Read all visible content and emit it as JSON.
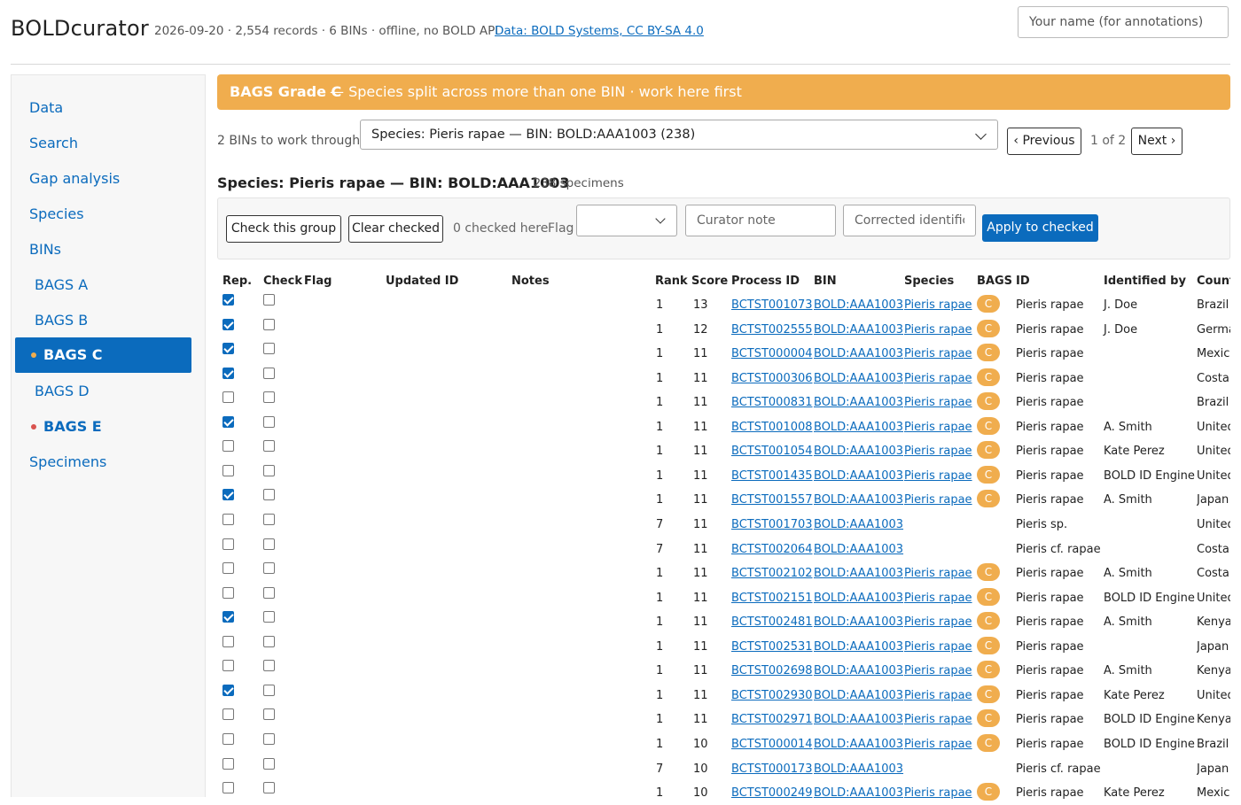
{
  "header": {
    "app_title": "BOLDcurator",
    "meta": "2026-09-20 · 2,554 records · 6 BINs · offline, no BOLD API",
    "data_link": "Data: BOLD Systems, CC BY-SA 4.0",
    "name_placeholder": "Your name (for annotations)"
  },
  "sidebar": {
    "items": [
      "Data",
      "Search",
      "Gap analysis",
      "Species",
      "BINs"
    ],
    "bags": [
      "BAGS A",
      "BAGS B",
      "BAGS C",
      "BAGS D",
      "BAGS E"
    ],
    "active": "BAGS C",
    "specimens": "Specimens",
    "dot_colors": {
      "bags_c": "#f0ad4e",
      "bags_e": "#d9534f"
    }
  },
  "banner": {
    "grade": "BAGS Grade C",
    "desc": "— Species split across more than one BIN · work here first",
    "color": "#f0ad4e"
  },
  "nav": {
    "work_label": "2 BINs to work through",
    "selected": "Species: Pieris rapae — BIN: BOLD:AAA1003 (238)",
    "prev": "‹ Previous",
    "page": "1 of 2",
    "next": "Next ›"
  },
  "group": {
    "title": "Species: Pieris rapae — BIN: BOLD:AAA1003",
    "count": "· 238 specimens"
  },
  "actions": {
    "check_group": "Check this group",
    "clear_checked": "Clear checked",
    "checked_count": "0 checked here",
    "flag_label": "Flag",
    "note_placeholder": "Curator note",
    "corrected_placeholder": "Corrected identification",
    "apply": "Apply to checked"
  },
  "table": {
    "headers": [
      "Rep.",
      "Check",
      "Flag",
      "Updated ID",
      "Notes",
      "Rank",
      "Score",
      "Process ID",
      "BIN",
      "Species",
      "BAGS",
      "ID",
      "Identified by",
      "Country"
    ],
    "rows": [
      {
        "rep": true,
        "rank": "1",
        "score": "13",
        "pid": "BCTST001073",
        "bin": "BOLD:AAA1003",
        "species": "Pieris rapae",
        "bags": "C",
        "id": "Pieris rapae",
        "by": "J. Doe",
        "country": "Brazil"
      },
      {
        "rep": true,
        "rank": "1",
        "score": "12",
        "pid": "BCTST002555",
        "bin": "BOLD:AAA1003",
        "species": "Pieris rapae",
        "bags": "C",
        "id": "Pieris rapae",
        "by": "J. Doe",
        "country": "Germany"
      },
      {
        "rep": true,
        "rank": "1",
        "score": "11",
        "pid": "BCTST000004",
        "bin": "BOLD:AAA1003",
        "species": "Pieris rapae",
        "bags": "C",
        "id": "Pieris rapae",
        "by": "",
        "country": "Mexico"
      },
      {
        "rep": true,
        "rank": "1",
        "score": "11",
        "pid": "BCTST000306",
        "bin": "BOLD:AAA1003",
        "species": "Pieris rapae",
        "bags": "C",
        "id": "Pieris rapae",
        "by": "",
        "country": "Costa Rica"
      },
      {
        "rep": false,
        "rank": "1",
        "score": "11",
        "pid": "BCTST000831",
        "bin": "BOLD:AAA1003",
        "species": "Pieris rapae",
        "bags": "C",
        "id": "Pieris rapae",
        "by": "",
        "country": "Brazil"
      },
      {
        "rep": true,
        "rank": "1",
        "score": "11",
        "pid": "BCTST001008",
        "bin": "BOLD:AAA1003",
        "species": "Pieris rapae",
        "bags": "C",
        "id": "Pieris rapae",
        "by": "A. Smith",
        "country": "United States"
      },
      {
        "rep": false,
        "rank": "1",
        "score": "11",
        "pid": "BCTST001054",
        "bin": "BOLD:AAA1003",
        "species": "Pieris rapae",
        "bags": "C",
        "id": "Pieris rapae",
        "by": "Kate Perez",
        "country": "United States"
      },
      {
        "rep": false,
        "rank": "1",
        "score": "11",
        "pid": "BCTST001435",
        "bin": "BOLD:AAA1003",
        "species": "Pieris rapae",
        "bags": "C",
        "id": "Pieris rapae",
        "by": "BOLD ID Engine",
        "country": "United States"
      },
      {
        "rep": true,
        "rank": "1",
        "score": "11",
        "pid": "BCTST001557",
        "bin": "BOLD:AAA1003",
        "species": "Pieris rapae",
        "bags": "C",
        "id": "Pieris rapae",
        "by": "A. Smith",
        "country": "Japan"
      },
      {
        "rep": false,
        "rank": "7",
        "score": "11",
        "pid": "BCTST001703",
        "bin": "BOLD:AAA1003",
        "species": "",
        "bags": "",
        "id": "Pieris sp.",
        "by": "",
        "country": "United States"
      },
      {
        "rep": false,
        "rank": "7",
        "score": "11",
        "pid": "BCTST002064",
        "bin": "BOLD:AAA1003",
        "species": "",
        "bags": "",
        "id": "Pieris cf. rapae",
        "by": "",
        "country": "Costa Rica"
      },
      {
        "rep": false,
        "rank": "1",
        "score": "11",
        "pid": "BCTST002102",
        "bin": "BOLD:AAA1003",
        "species": "Pieris rapae",
        "bags": "C",
        "id": "Pieris rapae",
        "by": "A. Smith",
        "country": "Costa Rica"
      },
      {
        "rep": false,
        "rank": "1",
        "score": "11",
        "pid": "BCTST002151",
        "bin": "BOLD:AAA1003",
        "species": "Pieris rapae",
        "bags": "C",
        "id": "Pieris rapae",
        "by": "BOLD ID Engine",
        "country": "United States"
      },
      {
        "rep": true,
        "rank": "1",
        "score": "11",
        "pid": "BCTST002481",
        "bin": "BOLD:AAA1003",
        "species": "Pieris rapae",
        "bags": "C",
        "id": "Pieris rapae",
        "by": "A. Smith",
        "country": "Kenya"
      },
      {
        "rep": false,
        "rank": "1",
        "score": "11",
        "pid": "BCTST002531",
        "bin": "BOLD:AAA1003",
        "species": "Pieris rapae",
        "bags": "C",
        "id": "Pieris rapae",
        "by": "",
        "country": "Japan"
      },
      {
        "rep": false,
        "rank": "1",
        "score": "11",
        "pid": "BCTST002698",
        "bin": "BOLD:AAA1003",
        "species": "Pieris rapae",
        "bags": "C",
        "id": "Pieris rapae",
        "by": "A. Smith",
        "country": "Kenya"
      },
      {
        "rep": true,
        "rank": "1",
        "score": "11",
        "pid": "BCTST002930",
        "bin": "BOLD:AAA1003",
        "species": "Pieris rapae",
        "bags": "C",
        "id": "Pieris rapae",
        "by": "Kate Perez",
        "country": "United States"
      },
      {
        "rep": false,
        "rank": "1",
        "score": "11",
        "pid": "BCTST002971",
        "bin": "BOLD:AAA1003",
        "species": "Pieris rapae",
        "bags": "C",
        "id": "Pieris rapae",
        "by": "BOLD ID Engine",
        "country": "Kenya"
      },
      {
        "rep": false,
        "rank": "1",
        "score": "10",
        "pid": "BCTST000014",
        "bin": "BOLD:AAA1003",
        "species": "Pieris rapae",
        "bags": "C",
        "id": "Pieris rapae",
        "by": "BOLD ID Engine",
        "country": "Brazil"
      },
      {
        "rep": false,
        "rank": "7",
        "score": "10",
        "pid": "BCTST000173",
        "bin": "BOLD:AAA1003",
        "species": "",
        "bags": "",
        "id": "Pieris cf. rapae",
        "by": "",
        "country": "Japan"
      },
      {
        "rep": false,
        "rank": "1",
        "score": "10",
        "pid": "BCTST000249",
        "bin": "BOLD:AAA1003",
        "species": "Pieris rapae",
        "bags": "C",
        "id": "Pieris rapae",
        "by": "Kate Perez",
        "country": "Mexico"
      }
    ]
  }
}
